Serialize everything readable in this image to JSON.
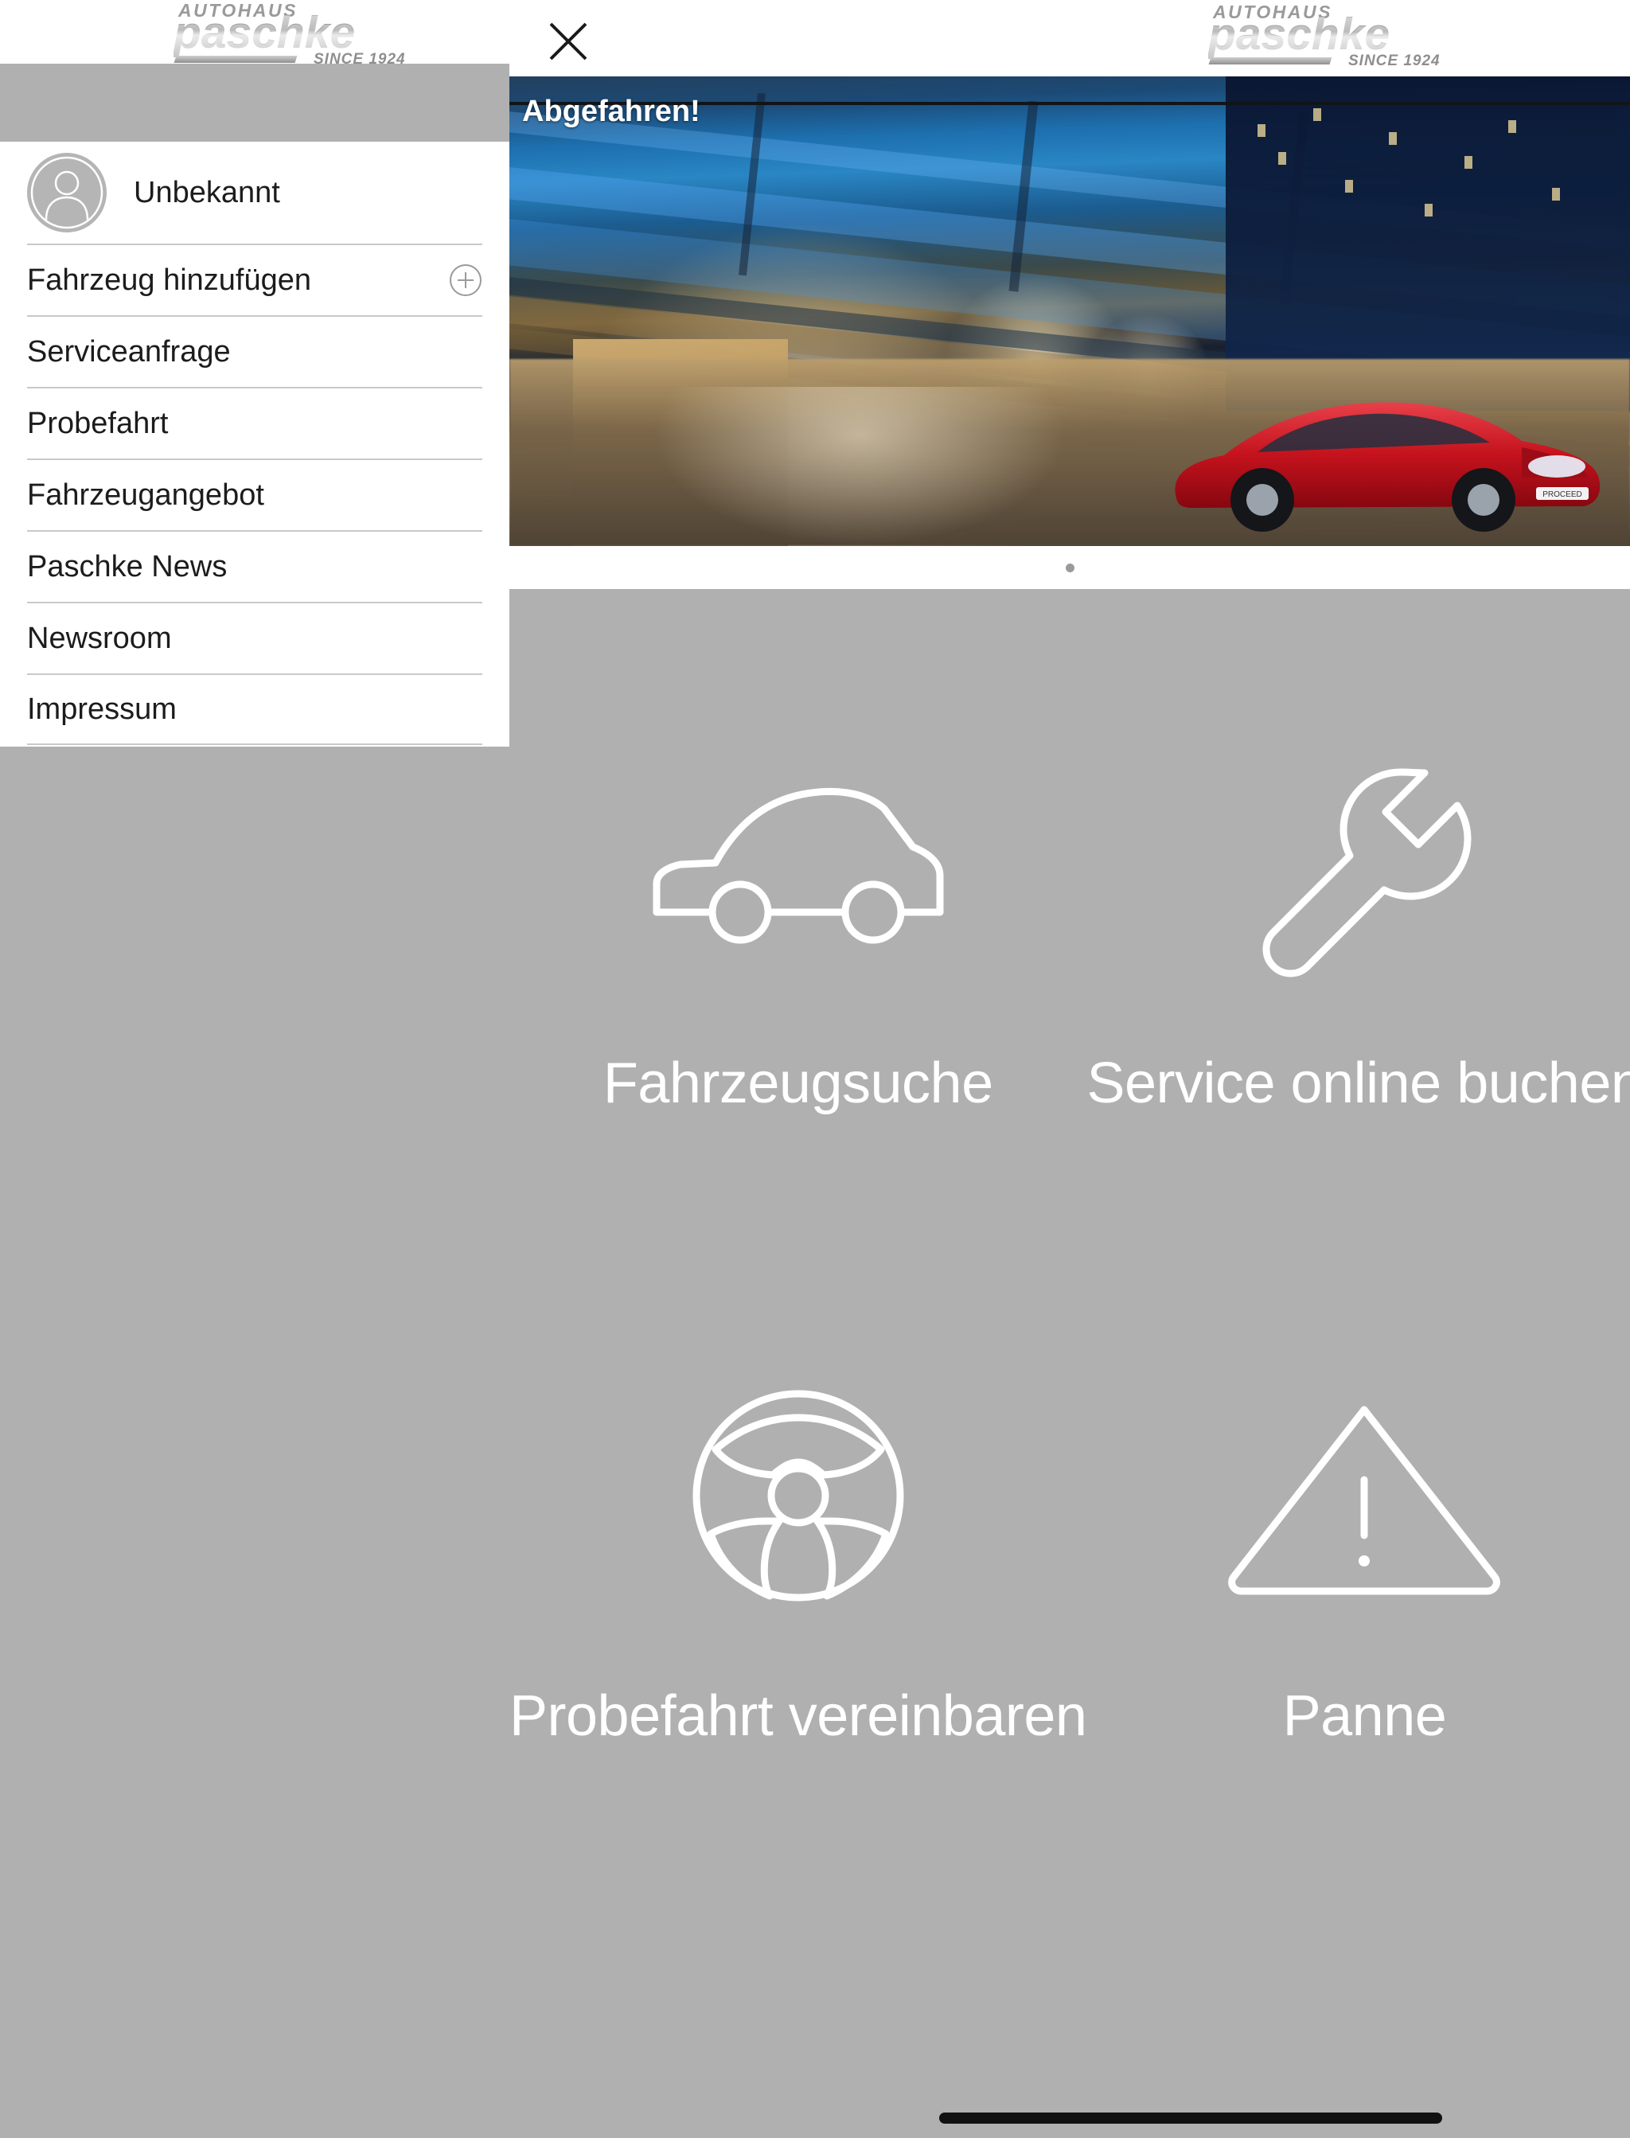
{
  "brand": {
    "logo_top": "AUTOHAUS",
    "logo_main": "paschke",
    "logo_since": "SINCE 1924",
    "accent_gray": "#b0b0b0",
    "white": "#ffffff"
  },
  "header": {
    "close_icon": "close-icon"
  },
  "hero": {
    "title": "Abgefahren!",
    "dot_count": 1,
    "active_dot_index": 0,
    "image_alt": "Roter Kia ProCeed bei Nacht unter einer blau beleuchteten Brücke"
  },
  "tiles": [
    {
      "label": "Fahrzeugsuche",
      "icon": "car-icon"
    },
    {
      "label": "Service online buchen",
      "icon": "wrench-icon"
    },
    {
      "label": "Probefahrt vereinbaren",
      "icon": "steering-wheel-icon"
    },
    {
      "label": "Panne",
      "icon": "warning-triangle-icon"
    }
  ],
  "drawer": {
    "profile": {
      "name": "Unbekannt",
      "avatar_icon": "person-avatar-icon"
    },
    "items": [
      {
        "label": "Fahrzeug hinzufügen",
        "trailing_icon": "plus-circle-icon"
      },
      {
        "label": "Serviceanfrage",
        "trailing_icon": ""
      },
      {
        "label": "Probefahrt",
        "trailing_icon": ""
      },
      {
        "label": "Fahrzeugangebot",
        "trailing_icon": ""
      },
      {
        "label": "Paschke News",
        "trailing_icon": ""
      },
      {
        "label": "Newsroom",
        "trailing_icon": ""
      },
      {
        "label": "Impressum",
        "trailing_icon": ""
      }
    ]
  }
}
